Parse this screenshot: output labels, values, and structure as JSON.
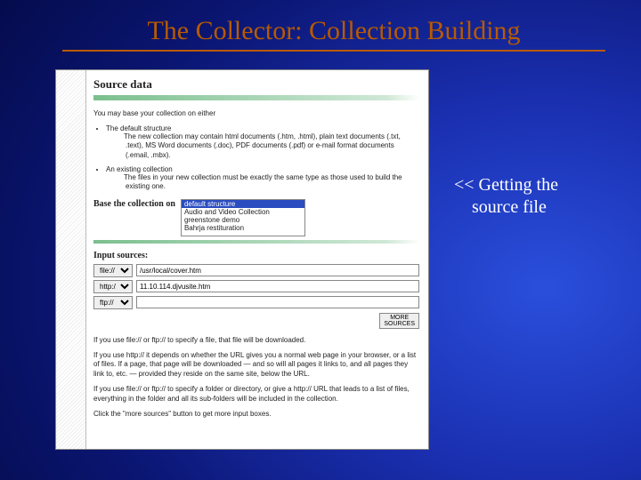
{
  "title": "The Collector: Collection Building",
  "annotation_line1": "<< Getting the",
  "annotation_line2": "source file",
  "panel": {
    "heading": "Source data",
    "intro": "You may base your collection on either",
    "bullet1": "The default structure",
    "bullet1_sub": "The new collection may contain html documents (.htm, .html), plain text documents (.txt, .text), MS Word documents (.doc), PDF documents (.pdf) or e-mail format documents (.email, .mbx).",
    "bullet2": "An existing collection",
    "bullet2_sub": "The files in your new collection must be exactly the same type as those used to build the existing one.",
    "base_label": "Base the collection on",
    "listbox": {
      "selected": "default structure",
      "opt2": "Audio and Video Collection",
      "opt3": "greenstone demo",
      "opt4": "Bahrja restituration"
    },
    "inputs_label": "Input sources:",
    "rows": [
      {
        "proto": "file://",
        "value": "/usr/local/cover.htm"
      },
      {
        "proto": "http://",
        "value": "11.10.114.djvusite.htm"
      },
      {
        "proto": "ftp://",
        "value": ""
      }
    ],
    "more_btn_l1": "MORE",
    "more_btn_l2": "SOURCES",
    "para_file": "If you use file:// or ftp:// to specify a file, that file will be downloaded.",
    "para_http": "If you use http:// it depends on whether the URL gives you a normal web page in your browser, or a list of files. If a page, that page will be downloaded — and so will all pages it links to, and all pages they link to, etc. — provided they reside on the same site, below the URL.",
    "para_dir": "If you use file:// or ftp:// to specify a folder or directory, or give a http:// URL that leads to a list of files, everything in the folder and all its sub-folders will be included in the collection.",
    "para_more": "Click the \"more sources\" button to get more input boxes."
  }
}
